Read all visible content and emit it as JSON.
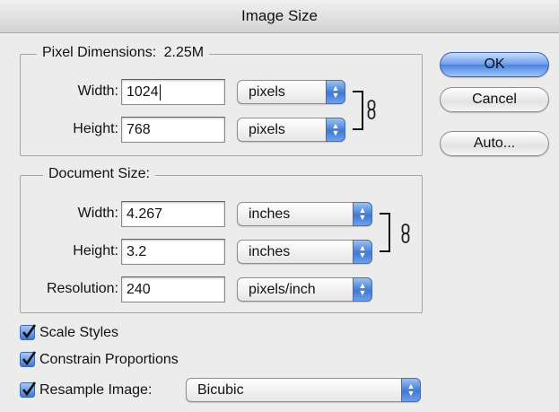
{
  "window": {
    "title": "Image Size"
  },
  "pixel_dimensions": {
    "legend": "Pixel Dimensions:",
    "size": "2.25M",
    "width": {
      "label": "Width:",
      "value": "1024",
      "unit": "pixels"
    },
    "height": {
      "label": "Height:",
      "value": "768",
      "unit": "pixels"
    }
  },
  "document_size": {
    "legend": "Document Size:",
    "width": {
      "label": "Width:",
      "value": "4.267",
      "unit": "inches"
    },
    "height": {
      "label": "Height:",
      "value": "3.2",
      "unit": "inches"
    },
    "resolution": {
      "label": "Resolution:",
      "value": "240",
      "unit": "pixels/inch"
    }
  },
  "buttons": {
    "ok": "OK",
    "cancel": "Cancel",
    "auto": "Auto..."
  },
  "options": {
    "scale_styles": {
      "label": "Scale Styles",
      "checked": true
    },
    "constrain_proportions": {
      "label": "Constrain Proportions",
      "checked": true
    },
    "resample_image": {
      "label": "Resample Image:",
      "checked": true,
      "method": "Bicubic"
    }
  },
  "colors": {
    "accent": "#4a84e0",
    "window_bg": "#ececec"
  },
  "icons": {
    "link": "chain-link-icon",
    "popup": "up-down-arrows-icon",
    "checkbox": "checkmark-icon"
  }
}
